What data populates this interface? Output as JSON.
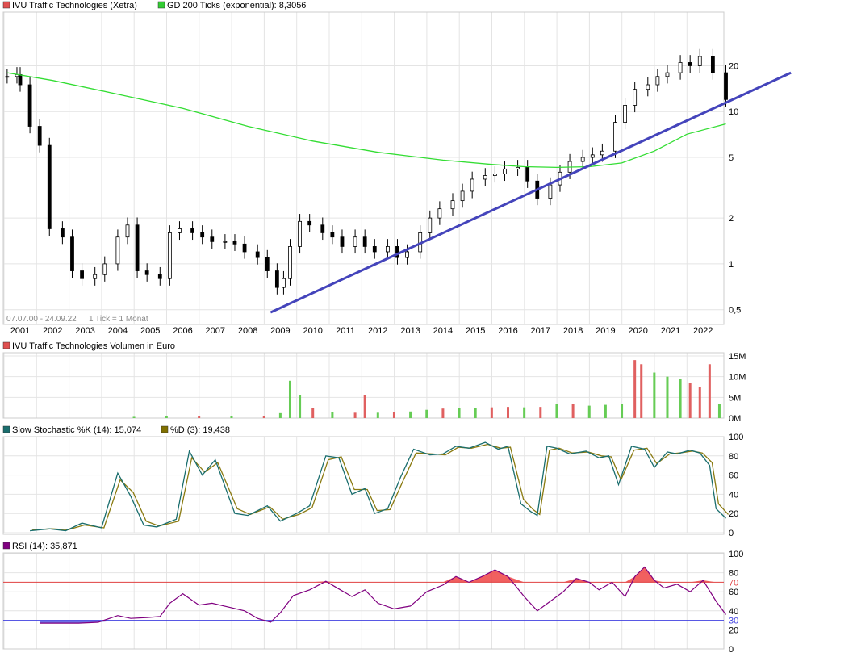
{
  "chart_data": [
    {
      "type": "candlestick",
      "legend": [
        {
          "label": "IVU Traffic Technologies (Xetra)",
          "color": "#e05050"
        },
        {
          "label": "GD 200 Ticks (exponential): 8,3056",
          "color": "#33cc33"
        }
      ],
      "date_range_note": "07.07.00 - 24.09.22",
      "tick_note": "1 Tick = 1 Monat",
      "y_scale": "log",
      "ylim": [
        0.4,
        45
      ],
      "y_ticks": [
        "0,5",
        "1",
        "2",
        "5",
        "10",
        "20"
      ],
      "x_labels": [
        "2001",
        "2002",
        "2003",
        "2004",
        "2005",
        "2006",
        "2007",
        "2008",
        "2009",
        "2010",
        "2011",
        "2012",
        "2013",
        "2014",
        "2015",
        "2016",
        "2017",
        "2018",
        "2019",
        "2020",
        "2021",
        "2022"
      ],
      "series": [
        {
          "name": "IVU Traffic Technologies (Xetra)",
          "x": [
            "2000.6",
            "2000.9",
            "2001.0",
            "2001.3",
            "2001.6",
            "2001.9",
            "2002.3",
            "2002.6",
            "2002.9",
            "2003.3",
            "2003.6",
            "2004.0",
            "2004.3",
            "2004.6",
            "2004.9",
            "2005.3",
            "2005.6",
            "2005.9",
            "2006.3",
            "2006.6",
            "2006.9",
            "2007.3",
            "2007.6",
            "2007.9",
            "2008.3",
            "2008.6",
            "2008.9",
            "2009.1",
            "2009.3",
            "2009.6",
            "2009.9",
            "2010.3",
            "2010.6",
            "2010.9",
            "2011.3",
            "2011.6",
            "2011.9",
            "2012.3",
            "2012.6",
            "2012.9",
            "2013.3",
            "2013.6",
            "2013.9",
            "2014.3",
            "2014.6",
            "2014.9",
            "2015.3",
            "2015.6",
            "2015.9",
            "2016.3",
            "2016.6",
            "2016.9",
            "2017.3",
            "2017.6",
            "2017.9",
            "2018.3",
            "2018.6",
            "2018.9",
            "2019.3",
            "2019.6",
            "2019.9",
            "2020.3",
            "2020.6",
            "2020.9",
            "2021.3",
            "2021.6",
            "2021.9",
            "2022.3",
            "2022.7"
          ],
          "values": [
            17,
            17.5,
            15,
            8,
            6,
            1.7,
            1.5,
            0.9,
            0.8,
            0.85,
            1,
            1.5,
            1.8,
            0.9,
            0.85,
            0.8,
            1.6,
            1.7,
            1.6,
            1.5,
            1.4,
            1.4,
            1.35,
            1.2,
            1.1,
            0.9,
            0.7,
            0.8,
            1.3,
            1.9,
            1.8,
            1.6,
            1.5,
            1.3,
            1.5,
            1.3,
            1.2,
            1.3,
            1.1,
            1.2,
            1.6,
            2.0,
            2.3,
            2.6,
            3.0,
            3.6,
            3.8,
            3.9,
            4.2,
            4.3,
            3.5,
            2.7,
            3.3,
            4.0,
            4.7,
            5.0,
            5.2,
            5.5,
            8.5,
            11,
            14,
            15,
            17,
            18,
            21,
            20,
            23,
            18,
            12
          ]
        },
        {
          "name": "GD 200 Ticks (exponential)",
          "x": [
            "2000.6",
            "2002.0",
            "2004.0",
            "2006.0",
            "2008.0",
            "2010.0",
            "2012.0",
            "2014.0",
            "2015.5",
            "2016.5",
            "2017.5",
            "2018.5",
            "2019.5",
            "2020.5",
            "2021.5",
            "2022.7"
          ],
          "values": [
            18,
            16,
            13,
            10.5,
            8,
            6.4,
            5.4,
            4.8,
            4.5,
            4.35,
            4.3,
            4.35,
            4.6,
            5.5,
            7.1,
            8.3
          ]
        },
        {
          "name": "Trendline",
          "x": [
            "2008.7",
            "2024.7"
          ],
          "values": [
            0.48,
            18
          ]
        }
      ]
    },
    {
      "type": "bar",
      "legend": [
        {
          "label": "IVU Traffic Technologies Volumen in Euro",
          "color": "#e05050"
        }
      ],
      "y_ticks": [
        "0M",
        "5M",
        "10M",
        "15M"
      ],
      "ylim": [
        0,
        15
      ],
      "unit": "Mio. Euro",
      "categories": [
        "2004.5",
        "2005.5",
        "2006.5",
        "2007.5",
        "2008.5",
        "2009.0",
        "2009.3",
        "2009.6",
        "2010.0",
        "2010.6",
        "2011.3",
        "2011.6",
        "2012.0",
        "2012.5",
        "2013.0",
        "2013.5",
        "2014.0",
        "2014.5",
        "2015.0",
        "2015.5",
        "2016.0",
        "2016.5",
        "2017.0",
        "2017.5",
        "2018.0",
        "2018.5",
        "2019.0",
        "2019.5",
        "2019.9",
        "2020.1",
        "2020.5",
        "2020.9",
        "2021.3",
        "2021.6",
        "2021.9",
        "2022.2",
        "2022.5"
      ],
      "values": [
        0.3,
        0.4,
        0.5,
        0.4,
        0.5,
        1.2,
        9,
        5.5,
        2.5,
        1.5,
        1.3,
        5.5,
        1.3,
        1.4,
        1.6,
        2.0,
        2.3,
        2.4,
        2.4,
        2.6,
        2.7,
        2.6,
        2.7,
        3.4,
        3.5,
        3.0,
        3.2,
        3.5,
        14,
        13,
        11,
        10,
        9.5,
        8.5,
        7.5,
        13,
        3.5
      ],
      "up": [
        true,
        true,
        false,
        true,
        false,
        true,
        true,
        true,
        false,
        true,
        false,
        false,
        true,
        false,
        true,
        true,
        false,
        true,
        true,
        false,
        false,
        true,
        false,
        true,
        false,
        true,
        true,
        true,
        false,
        false,
        true,
        true,
        true,
        false,
        false,
        false,
        true
      ]
    },
    {
      "type": "line",
      "legend": [
        {
          "label": "Slow Stochastic %K (14): 15,074",
          "color": "#1a6e6e"
        },
        {
          "label": "%D (3): 19,438",
          "color": "#807000"
        }
      ],
      "y_ticks": [
        "0",
        "20",
        "40",
        "60",
        "80",
        "100"
      ],
      "ylim": [
        0,
        100
      ],
      "x": [
        "2001.3",
        "2001.9",
        "2002.4",
        "2002.9",
        "2003.5",
        "2004.0",
        "2004.4",
        "2004.8",
        "2005.2",
        "2005.8",
        "2006.2",
        "2006.6",
        "2007.0",
        "2007.6",
        "2008.0",
        "2008.6",
        "2009.0",
        "2009.5",
        "2009.9",
        "2010.4",
        "2010.8",
        "2011.2",
        "2011.6",
        "2011.9",
        "2012.3",
        "2012.7",
        "2013.1",
        "2013.6",
        "2014.0",
        "2014.4",
        "2014.8",
        "2015.3",
        "2015.7",
        "2016.0",
        "2016.4",
        "2016.7",
        "2016.9",
        "2017.2",
        "2017.5",
        "2017.9",
        "2018.4",
        "2018.8",
        "2019.1",
        "2019.4",
        "2019.8",
        "2020.2",
        "2020.5",
        "2020.9",
        "2021.2",
        "2021.6",
        "2021.9",
        "2022.2",
        "2022.4",
        "2022.7"
      ],
      "k": [
        2,
        4,
        2,
        10,
        5,
        62,
        38,
        8,
        6,
        14,
        85,
        60,
        76,
        20,
        18,
        28,
        12,
        20,
        28,
        80,
        78,
        40,
        46,
        20,
        25,
        58,
        87,
        81,
        82,
        90,
        88,
        94,
        87,
        90,
        30,
        22,
        18,
        90,
        88,
        82,
        85,
        78,
        80,
        50,
        90,
        87,
        68,
        84,
        82,
        86,
        83,
        70,
        25,
        15
      ],
      "d": [
        3,
        4,
        3,
        8,
        5,
        55,
        42,
        12,
        7,
        12,
        78,
        63,
        73,
        25,
        19,
        27,
        14,
        19,
        26,
        76,
        79,
        45,
        45,
        23,
        24,
        54,
        83,
        82,
        81,
        89,
        88,
        92,
        88,
        89,
        35,
        24,
        19,
        86,
        88,
        83,
        84,
        80,
        79,
        55,
        86,
        88,
        72,
        82,
        83,
        85,
        83,
        73,
        30,
        19
      ]
    },
    {
      "type": "line",
      "legend": [
        {
          "label": "RSI (14): 35,871",
          "color": "#800080"
        }
      ],
      "y_ticks": [
        "0",
        "20",
        "30",
        "40",
        "60",
        "70",
        "80",
        "100"
      ],
      "ylim": [
        0,
        100
      ],
      "reference_lines": [
        {
          "value": 70,
          "color": "#e04040"
        },
        {
          "value": 30,
          "color": "#4040e0"
        }
      ],
      "x": [
        "2001.6",
        "2002.2",
        "2002.8",
        "2003.4",
        "2004.0",
        "2004.4",
        "2004.9",
        "2005.3",
        "2005.6",
        "2006.0",
        "2006.5",
        "2006.9",
        "2007.4",
        "2007.9",
        "2008.3",
        "2008.7",
        "2009.0",
        "2009.4",
        "2009.9",
        "2010.4",
        "2010.8",
        "2011.2",
        "2011.6",
        "2012.0",
        "2012.5",
        "2013.0",
        "2013.5",
        "2014.0",
        "2014.4",
        "2014.8",
        "2015.2",
        "2015.6",
        "2016.0",
        "2016.5",
        "2016.9",
        "2017.3",
        "2017.7",
        "2018.1",
        "2018.5",
        "2018.8",
        "2019.2",
        "2019.6",
        "2019.9",
        "2020.2",
        "2020.5",
        "2020.8",
        "2021.2",
        "2021.6",
        "2022.0",
        "2022.4",
        "2022.7"
      ],
      "values": [
        27,
        27,
        27,
        28,
        35,
        32,
        33,
        34,
        48,
        58,
        46,
        48,
        44,
        40,
        32,
        28,
        38,
        56,
        62,
        71,
        63,
        55,
        62,
        48,
        42,
        45,
        60,
        67,
        76,
        70,
        76,
        83,
        76,
        55,
        40,
        50,
        60,
        74,
        70,
        62,
        70,
        55,
        76,
        86,
        72,
        64,
        68,
        60,
        72,
        50,
        36
      ]
    }
  ]
}
